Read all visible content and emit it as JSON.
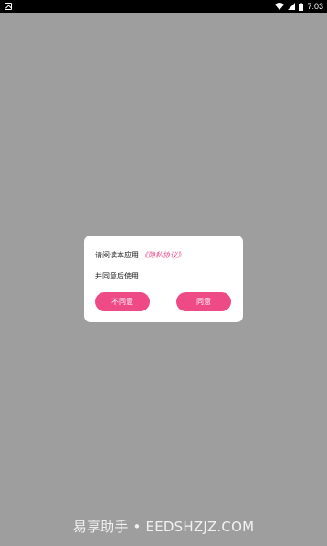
{
  "status_bar": {
    "time": "7:03",
    "icons": [
      "notification-icon",
      "wifi-icon",
      "signal-icon",
      "battery-icon"
    ]
  },
  "dialog": {
    "line1_prefix": "请阅读本应用",
    "privacy_link": "《隐私协议》",
    "line2": "并同意后使用",
    "disagree_label": "不同意",
    "agree_label": "同意"
  },
  "watermark": {
    "text": "易享助手 • EEDSHZJZ.COM"
  },
  "colors": {
    "background": "#9e9e9e",
    "accent": "#ee4b86",
    "link": "#e84a88",
    "dialog": "#ffffff"
  }
}
